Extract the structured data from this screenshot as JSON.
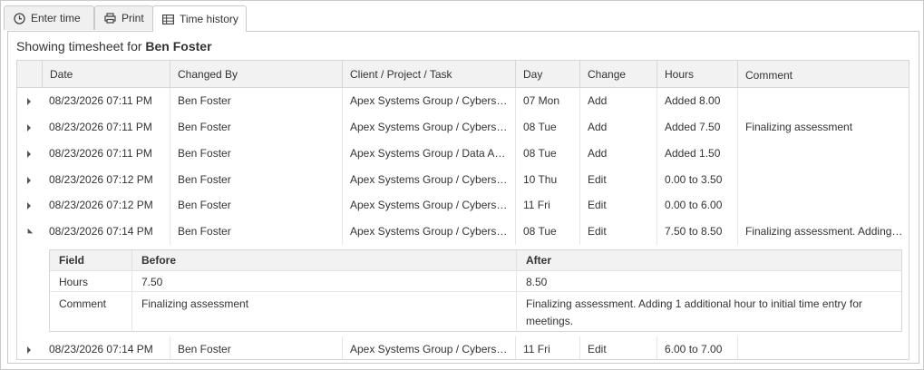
{
  "tabs": [
    {
      "label": "Enter time",
      "icon": "clock-icon"
    },
    {
      "label": "Print",
      "icon": "printer-icon"
    },
    {
      "label": "Time history",
      "icon": "table-icon"
    }
  ],
  "heading": {
    "prefix": "Showing timesheet for ",
    "name": "Ben Foster"
  },
  "columns": [
    "Date",
    "Changed By",
    "Client / Project / Task",
    "Day",
    "Change",
    "Hours",
    "Comment"
  ],
  "rows": [
    {
      "date": "08/23/2026 07:11 PM",
      "by": "Ben Foster",
      "task": "Apex Systems Group / Cybers…",
      "day": "07 Mon",
      "change": "Add",
      "hours": "Added 8.00",
      "comment": ""
    },
    {
      "date": "08/23/2026 07:11 PM",
      "by": "Ben Foster",
      "task": "Apex Systems Group / Cybers…",
      "day": "08 Tue",
      "change": "Add",
      "hours": "Added 7.50",
      "comment": "Finalizing assessment"
    },
    {
      "date": "08/23/2026 07:11 PM",
      "by": "Ben Foster",
      "task": "Apex Systems Group / Data A…",
      "day": "08 Tue",
      "change": "Add",
      "hours": "Added 1.50",
      "comment": ""
    },
    {
      "date": "08/23/2026 07:12 PM",
      "by": "Ben Foster",
      "task": "Apex Systems Group / Cybers…",
      "day": "10 Thu",
      "change": "Edit",
      "hours": "0.00 to 3.50",
      "comment": ""
    },
    {
      "date": "08/23/2026 07:12 PM",
      "by": "Ben Foster",
      "task": "Apex Systems Group / Cybers…",
      "day": "11 Fri",
      "change": "Edit",
      "hours": "0.00 to 6.00",
      "comment": ""
    },
    {
      "date": "08/23/2026 07:14 PM",
      "by": "Ben Foster",
      "task": "Apex Systems Group / Cybers…",
      "day": "08 Tue",
      "change": "Edit",
      "hours": "7.50 to 8.50",
      "comment": "Finalizing assessment. Adding…"
    },
    {
      "date": "08/23/2026 07:14 PM",
      "by": "Ben Foster",
      "task": "Apex Systems Group / Cybers…",
      "day": "11 Fri",
      "change": "Edit",
      "hours": "6.00 to 7.00",
      "comment": ""
    }
  ],
  "detail": {
    "columns": [
      "Field",
      "Before",
      "After"
    ],
    "rows": [
      {
        "field": "Hours",
        "before": "7.50",
        "after": "8.50"
      },
      {
        "field": "Comment",
        "before": "Finalizing assessment",
        "after": "Finalizing assessment. Adding 1 additional hour to initial time entry for meetings."
      }
    ]
  }
}
